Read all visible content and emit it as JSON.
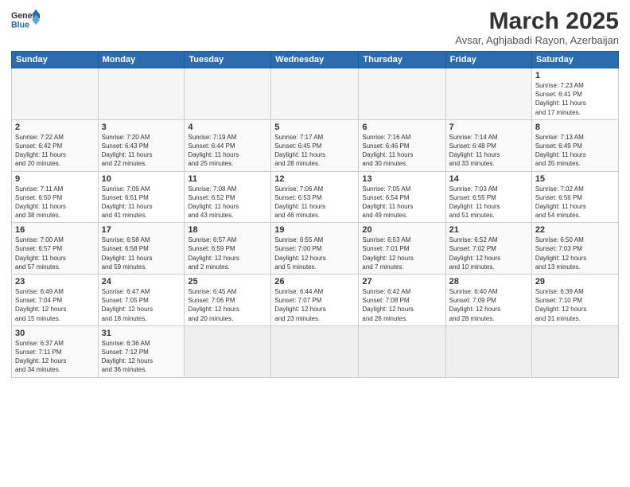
{
  "header": {
    "logo_general": "General",
    "logo_blue": "Blue",
    "month_title": "March 2025",
    "subtitle": "Avsar, Aghjabadi Rayon, Azerbaijan"
  },
  "weekdays": [
    "Sunday",
    "Monday",
    "Tuesday",
    "Wednesday",
    "Thursday",
    "Friday",
    "Saturday"
  ],
  "weeks": [
    [
      {
        "day": "",
        "info": ""
      },
      {
        "day": "",
        "info": ""
      },
      {
        "day": "",
        "info": ""
      },
      {
        "day": "",
        "info": ""
      },
      {
        "day": "",
        "info": ""
      },
      {
        "day": "",
        "info": ""
      },
      {
        "day": "1",
        "info": "Sunrise: 7:23 AM\nSunset: 6:41 PM\nDaylight: 11 hours\nand 17 minutes."
      }
    ],
    [
      {
        "day": "2",
        "info": "Sunrise: 7:22 AM\nSunset: 6:42 PM\nDaylight: 11 hours\nand 20 minutes."
      },
      {
        "day": "3",
        "info": "Sunrise: 7:20 AM\nSunset: 6:43 PM\nDaylight: 11 hours\nand 22 minutes."
      },
      {
        "day": "4",
        "info": "Sunrise: 7:19 AM\nSunset: 6:44 PM\nDaylight: 11 hours\nand 25 minutes."
      },
      {
        "day": "5",
        "info": "Sunrise: 7:17 AM\nSunset: 6:45 PM\nDaylight: 11 hours\nand 28 minutes."
      },
      {
        "day": "6",
        "info": "Sunrise: 7:16 AM\nSunset: 6:46 PM\nDaylight: 11 hours\nand 30 minutes."
      },
      {
        "day": "7",
        "info": "Sunrise: 7:14 AM\nSunset: 6:48 PM\nDaylight: 11 hours\nand 33 minutes."
      },
      {
        "day": "8",
        "info": "Sunrise: 7:13 AM\nSunset: 6:49 PM\nDaylight: 11 hours\nand 35 minutes."
      }
    ],
    [
      {
        "day": "9",
        "info": "Sunrise: 7:11 AM\nSunset: 6:50 PM\nDaylight: 11 hours\nand 38 minutes."
      },
      {
        "day": "10",
        "info": "Sunrise: 7:09 AM\nSunset: 6:51 PM\nDaylight: 11 hours\nand 41 minutes."
      },
      {
        "day": "11",
        "info": "Sunrise: 7:08 AM\nSunset: 6:52 PM\nDaylight: 11 hours\nand 43 minutes."
      },
      {
        "day": "12",
        "info": "Sunrise: 7:06 AM\nSunset: 6:53 PM\nDaylight: 11 hours\nand 46 minutes."
      },
      {
        "day": "13",
        "info": "Sunrise: 7:05 AM\nSunset: 6:54 PM\nDaylight: 11 hours\nand 49 minutes."
      },
      {
        "day": "14",
        "info": "Sunrise: 7:03 AM\nSunset: 6:55 PM\nDaylight: 11 hours\nand 51 minutes."
      },
      {
        "day": "15",
        "info": "Sunrise: 7:02 AM\nSunset: 6:56 PM\nDaylight: 11 hours\nand 54 minutes."
      }
    ],
    [
      {
        "day": "16",
        "info": "Sunrise: 7:00 AM\nSunset: 6:57 PM\nDaylight: 11 hours\nand 57 minutes."
      },
      {
        "day": "17",
        "info": "Sunrise: 6:58 AM\nSunset: 6:58 PM\nDaylight: 11 hours\nand 59 minutes."
      },
      {
        "day": "18",
        "info": "Sunrise: 6:57 AM\nSunset: 6:59 PM\nDaylight: 12 hours\nand 2 minutes."
      },
      {
        "day": "19",
        "info": "Sunrise: 6:55 AM\nSunset: 7:00 PM\nDaylight: 12 hours\nand 5 minutes."
      },
      {
        "day": "20",
        "info": "Sunrise: 6:53 AM\nSunset: 7:01 PM\nDaylight: 12 hours\nand 7 minutes."
      },
      {
        "day": "21",
        "info": "Sunrise: 6:52 AM\nSunset: 7:02 PM\nDaylight: 12 hours\nand 10 minutes."
      },
      {
        "day": "22",
        "info": "Sunrise: 6:50 AM\nSunset: 7:03 PM\nDaylight: 12 hours\nand 13 minutes."
      }
    ],
    [
      {
        "day": "23",
        "info": "Sunrise: 6:49 AM\nSunset: 7:04 PM\nDaylight: 12 hours\nand 15 minutes."
      },
      {
        "day": "24",
        "info": "Sunrise: 6:47 AM\nSunset: 7:05 PM\nDaylight: 12 hours\nand 18 minutes."
      },
      {
        "day": "25",
        "info": "Sunrise: 6:45 AM\nSunset: 7:06 PM\nDaylight: 12 hours\nand 20 minutes."
      },
      {
        "day": "26",
        "info": "Sunrise: 6:44 AM\nSunset: 7:07 PM\nDaylight: 12 hours\nand 23 minutes."
      },
      {
        "day": "27",
        "info": "Sunrise: 6:42 AM\nSunset: 7:08 PM\nDaylight: 12 hours\nand 26 minutes."
      },
      {
        "day": "28",
        "info": "Sunrise: 6:40 AM\nSunset: 7:09 PM\nDaylight: 12 hours\nand 28 minutes."
      },
      {
        "day": "29",
        "info": "Sunrise: 6:39 AM\nSunset: 7:10 PM\nDaylight: 12 hours\nand 31 minutes."
      }
    ],
    [
      {
        "day": "30",
        "info": "Sunrise: 6:37 AM\nSunset: 7:11 PM\nDaylight: 12 hours\nand 34 minutes."
      },
      {
        "day": "31",
        "info": "Sunrise: 6:36 AM\nSunset: 7:12 PM\nDaylight: 12 hours\nand 36 minutes."
      },
      {
        "day": "",
        "info": ""
      },
      {
        "day": "",
        "info": ""
      },
      {
        "day": "",
        "info": ""
      },
      {
        "day": "",
        "info": ""
      },
      {
        "day": "",
        "info": ""
      }
    ]
  ]
}
